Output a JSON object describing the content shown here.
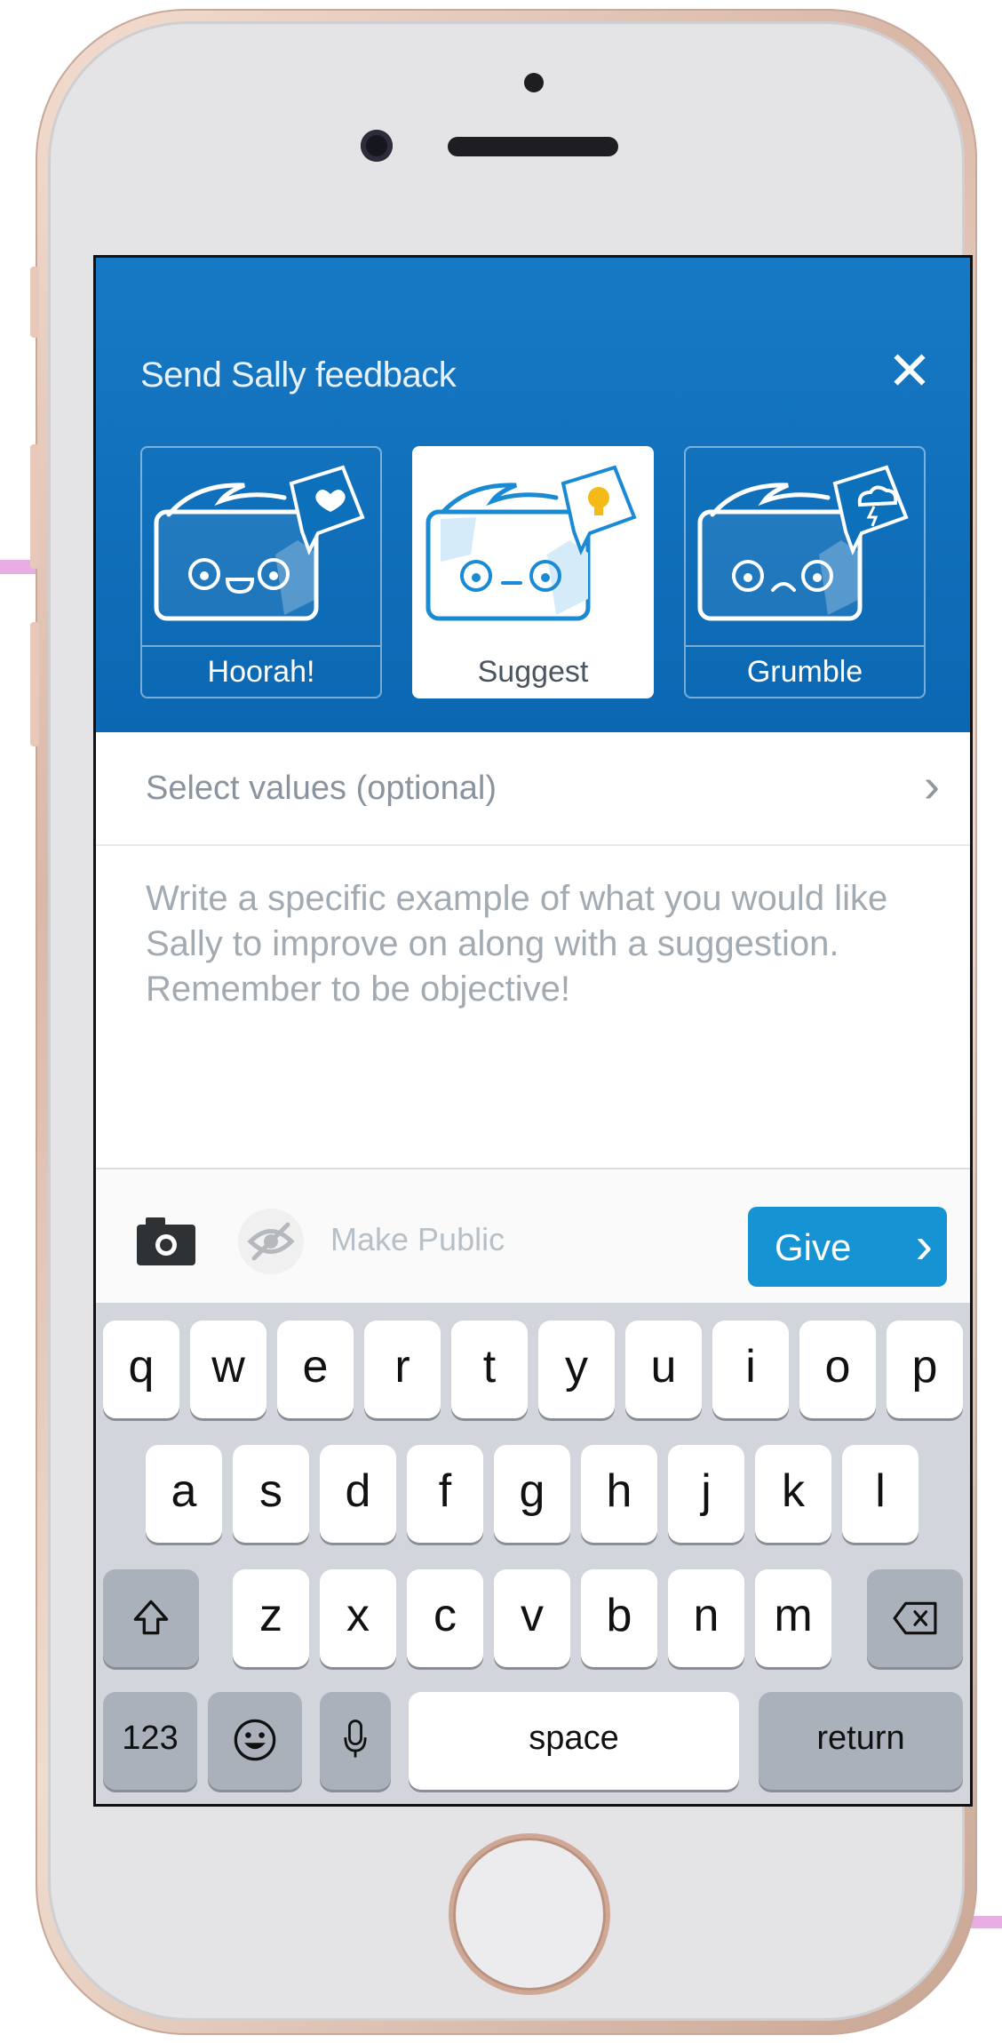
{
  "header": {
    "title": "Send Sally feedback",
    "close_icon": "close-icon"
  },
  "feedback_types": [
    {
      "label": "Hoorah!",
      "badge": "heart",
      "selected": false
    },
    {
      "label": "Suggest",
      "badge": "lightbulb",
      "selected": true
    },
    {
      "label": "Grumble",
      "badge": "storm-cloud",
      "selected": false
    }
  ],
  "values_row": {
    "label": "Select values (optional)"
  },
  "message": {
    "placeholder": "Write a specific example of what you would like Sally to improve on along with a suggestion. Remember to be objective!"
  },
  "toolbar": {
    "make_public": "Make Public",
    "give": "Give"
  },
  "keyboard": {
    "row1": [
      "q",
      "w",
      "e",
      "r",
      "t",
      "y",
      "u",
      "i",
      "o",
      "p"
    ],
    "row2": [
      "a",
      "s",
      "d",
      "f",
      "g",
      "h",
      "j",
      "k",
      "l"
    ],
    "row3": [
      "z",
      "x",
      "c",
      "v",
      "b",
      "n",
      "m"
    ],
    "numbers": "123",
    "space": "space",
    "return": "return"
  },
  "colors": {
    "brand_blue": "#0b67b2",
    "button_blue": "#1593d3",
    "card_pink_accent": "#e8a8e0"
  }
}
